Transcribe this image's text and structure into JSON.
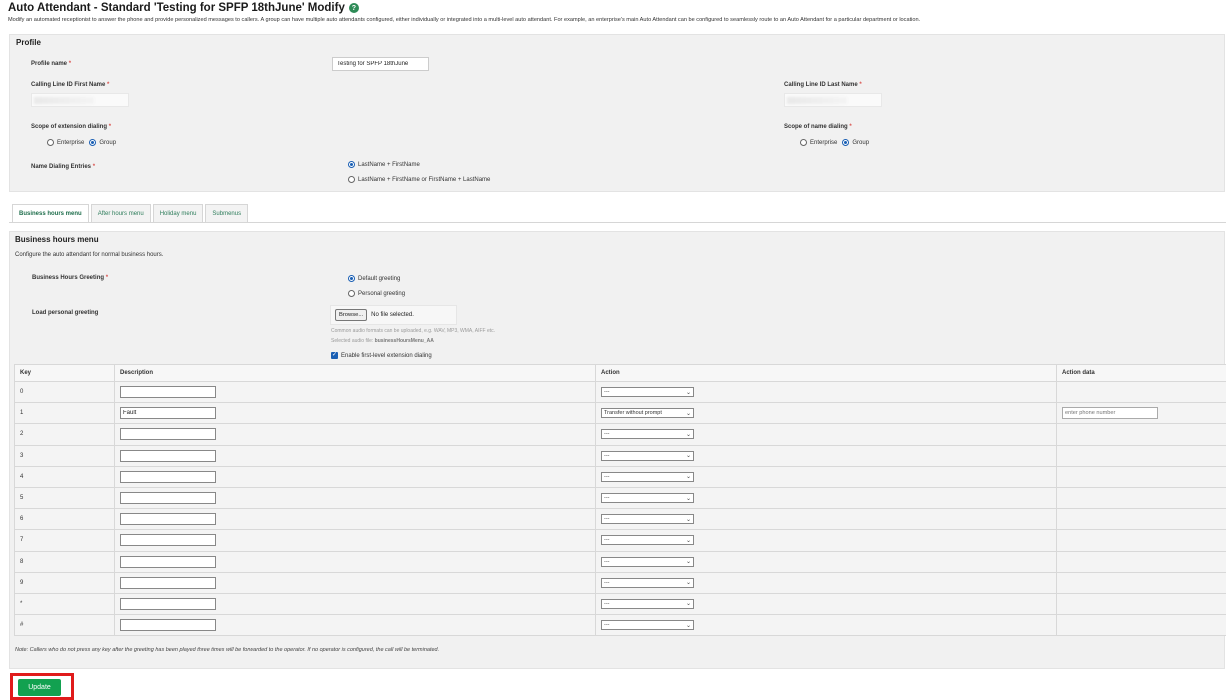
{
  "header": {
    "title": "Auto Attendant - Standard 'Testing for SPFP 18thJune' Modify",
    "help_icon": "question-circle-icon",
    "description": "Modify an automated receptionist to answer the phone and provide personalized messages to callers. A group can have multiple auto attendants configured, either individually or integrated into a multi-level auto attendant. For example, an enterprise's main Auto Attendant can be configured to seamlessly route to an Auto Attendant for a particular department or location."
  },
  "profile": {
    "heading": "Profile",
    "profile_name_label": "Profile name",
    "profile_name_value": "Testing for SPFP 18thJune",
    "clid_first_label": "Calling Line ID First Name",
    "clid_last_label": "Calling Line ID Last Name",
    "scope_ext_label": "Scope of extension dialing",
    "scope_name_label": "Scope of name dialing",
    "opt_enterprise": "Enterprise",
    "opt_group": "Group",
    "name_dialing_label": "Name Dialing Entries",
    "name_dialing_opt1": "LastName + FirstName",
    "name_dialing_opt2": "LastName + FirstName or FirstName + LastName",
    "required_mark": "*"
  },
  "tabs": [
    {
      "label": "Business hours menu",
      "active": true
    },
    {
      "label": "After hours menu",
      "active": false
    },
    {
      "label": "Holiday menu",
      "active": false
    },
    {
      "label": "Submenus",
      "active": false
    }
  ],
  "business_hours": {
    "heading": "Business hours menu",
    "subtitle": "Configure the auto attendant for normal business hours.",
    "greeting_label": "Business Hours Greeting",
    "greeting_default": "Default greeting",
    "greeting_personal": "Personal greeting",
    "load_label": "Load personal greeting",
    "browse_label": "Browse...",
    "no_file": "No file selected.",
    "formats_hint": "Common audio formats can be uploaded, e.g. WAV, MP3, WMA, AIFF etc.",
    "selected_prefix": "Selected audio file:",
    "selected_file": "businessHoursMenu_AA",
    "extension_dialing": "Enable first-level extension dialing"
  },
  "table": {
    "headers": [
      "Key",
      "Description",
      "Action",
      "Action data"
    ],
    "rows": [
      {
        "key": "0",
        "description": "",
        "action": "---",
        "action_data": ""
      },
      {
        "key": "1",
        "description": "Fault",
        "action": "Transfer without prompt",
        "action_data": "enter phone number"
      },
      {
        "key": "2",
        "description": "",
        "action": "---",
        "action_data": ""
      },
      {
        "key": "3",
        "description": "",
        "action": "---",
        "action_data": ""
      },
      {
        "key": "4",
        "description": "",
        "action": "---",
        "action_data": ""
      },
      {
        "key": "5",
        "description": "",
        "action": "---",
        "action_data": ""
      },
      {
        "key": "6",
        "description": "",
        "action": "---",
        "action_data": ""
      },
      {
        "key": "7",
        "description": "",
        "action": "---",
        "action_data": ""
      },
      {
        "key": "8",
        "description": "",
        "action": "---",
        "action_data": ""
      },
      {
        "key": "9",
        "description": "",
        "action": "---",
        "action_data": ""
      },
      {
        "key": "*",
        "description": "",
        "action": "---",
        "action_data": ""
      },
      {
        "key": "#",
        "description": "",
        "action": "---",
        "action_data": ""
      }
    ]
  },
  "note": "Note: Callers who do not press any key after the greeting has been played three times will be forwarded to the operator. If no operator is configured, the call will be terminated.",
  "footer": {
    "update_label": "Update"
  },
  "colors": {
    "accent_green": "#12a150",
    "highlight_red": "#e01b1b",
    "radio_blue": "#1a5fb4"
  }
}
